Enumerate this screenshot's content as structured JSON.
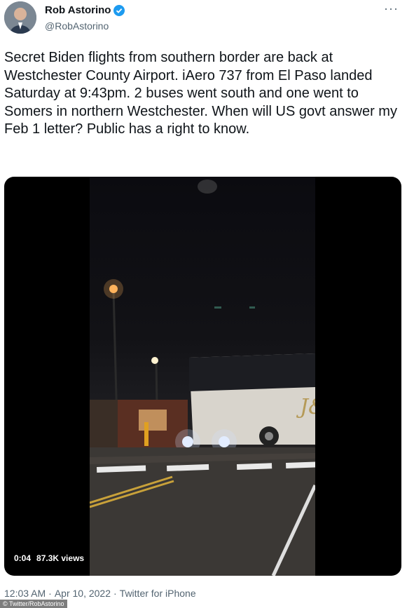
{
  "author": {
    "display_name": "Rob Astorino",
    "handle": "@RobAstorino"
  },
  "more_menu": "···",
  "tweet": {
    "text": "Secret Biden flights from southern border are back at Westchester County Airport.  iAero 737 from El Paso landed Saturday at 9:43pm. 2 buses went south and one went to Somers in northern Westchester.  When will US govt answer my Feb 1 letter?  Public has a right to know."
  },
  "video": {
    "time": "0:04",
    "views": "87.3K views",
    "bus_logo": "J&"
  },
  "meta": {
    "time": "12:03 AM",
    "sep1": "·",
    "date": "Apr 10, 2022",
    "sep2": "·",
    "source": "Twitter for iPhone"
  },
  "credit": "© Twitter/RobAstorino",
  "colors": {
    "verified": "#1d9bf0",
    "muted": "#536471",
    "text": "#0f1419"
  }
}
